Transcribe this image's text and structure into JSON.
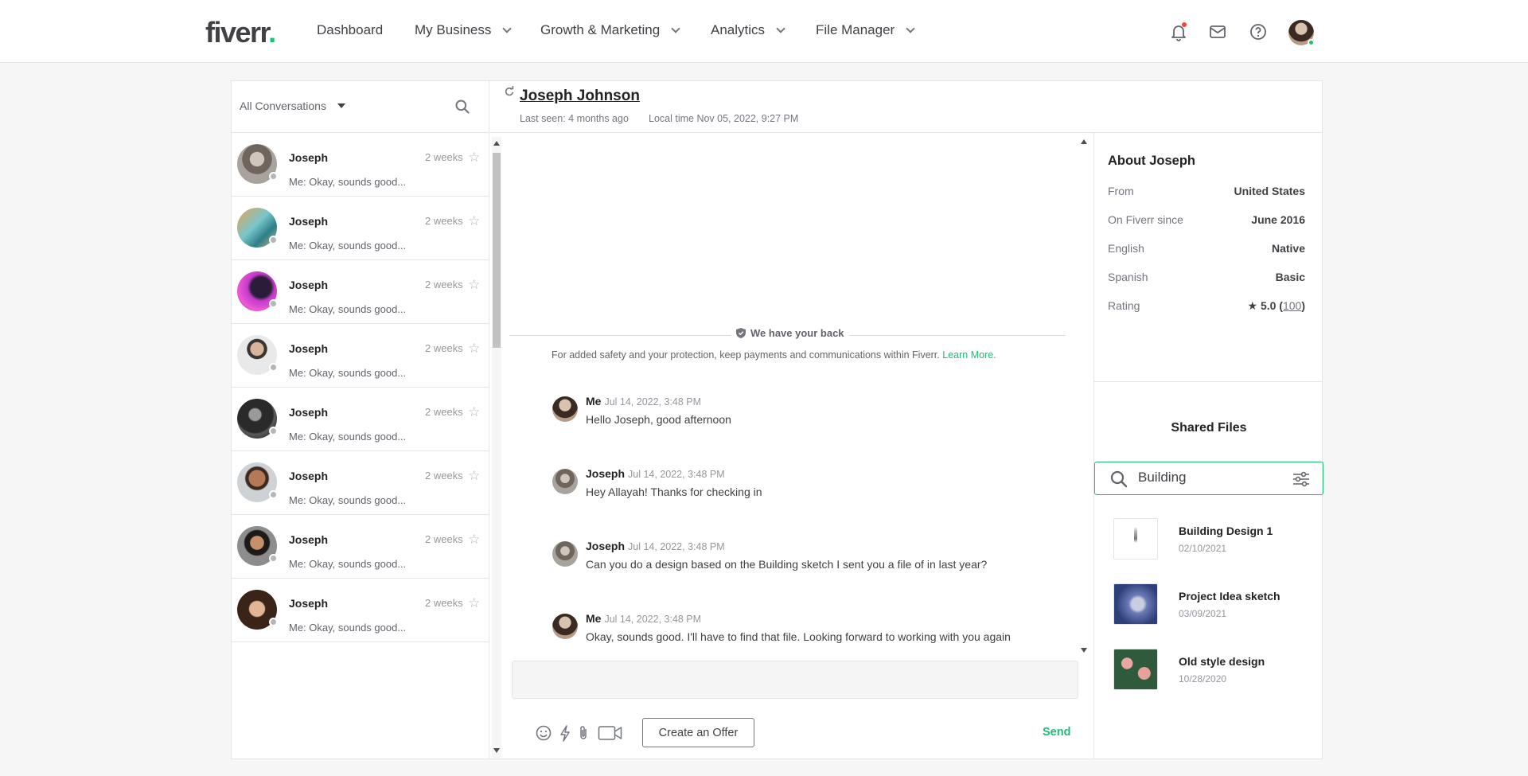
{
  "nav": {
    "logo_text": "fiverr",
    "logo_dot": ".",
    "items": [
      {
        "label": "Dashboard",
        "has_dropdown": false
      },
      {
        "label": "My Business",
        "has_dropdown": true
      },
      {
        "label": "Growth & Marketing",
        "has_dropdown": true
      },
      {
        "label": "Analytics",
        "has_dropdown": true
      },
      {
        "label": "File Manager",
        "has_dropdown": true
      }
    ],
    "icons": [
      "bell-icon",
      "mail-icon",
      "help-icon"
    ],
    "accent_color": "#1dbf73"
  },
  "conversations": {
    "filter_label": "All Conversations",
    "items": [
      {
        "name": "Joseph",
        "time": "2 weeks",
        "preview": "Me: Okay, sounds good..."
      },
      {
        "name": "Joseph",
        "time": "2 weeks",
        "preview": "Me: Okay, sounds good..."
      },
      {
        "name": "Joseph",
        "time": "2 weeks",
        "preview": "Me: Okay, sounds good..."
      },
      {
        "name": "Joseph",
        "time": "2 weeks",
        "preview": "Me: Okay, sounds good..."
      },
      {
        "name": "Joseph",
        "time": "2 weeks",
        "preview": "Me: Okay, sounds good..."
      },
      {
        "name": "Joseph",
        "time": "2 weeks",
        "preview": "Me: Okay, sounds good..."
      },
      {
        "name": "Joseph",
        "time": "2 weeks",
        "preview": "Me: Okay, sounds good..."
      },
      {
        "name": "Joseph",
        "time": "2 weeks",
        "preview": "Me: Okay, sounds good..."
      }
    ]
  },
  "chat": {
    "contact_name": "Joseph Johnson",
    "last_seen": "Last seen: 4 months ago",
    "local_time": "Local time Nov 05, 2022, 9:27 PM",
    "safety_title": "We have your back",
    "safety_text": "For added safety and your protection, keep payments and communications within Fiverr.",
    "safety_link": "Learn More.",
    "messages": [
      {
        "sender": "Me",
        "time": "Jul 14, 2022, 3:48 PM",
        "text": "Hello Joseph, good afternoon"
      },
      {
        "sender": "Joseph",
        "time": "Jul 14, 2022, 3:48 PM",
        "text": "Hey Allayah! Thanks for checking in"
      },
      {
        "sender": "Joseph",
        "time": "Jul 14, 2022, 3:48 PM",
        "text": "Can you do a design based on the Building sketch I sent you a file of in last year?"
      },
      {
        "sender": "Me",
        "time": "Jul 14, 2022, 3:48 PM",
        "text": "Okay, sounds good. I'll have to find that file. Looking forward to working with you again"
      }
    ],
    "composer_placeholder": "",
    "offer_label": "Create an Offer",
    "send_label": "Send"
  },
  "about": {
    "title": "About Joseph",
    "rows": [
      {
        "key": "From",
        "value": "United States"
      },
      {
        "key": "On Fiverr since",
        "value": "June 2016"
      },
      {
        "key": "English",
        "value": "Native"
      },
      {
        "key": "Spanish",
        "value": "Basic"
      }
    ],
    "rating_label": "Rating",
    "rating_value": "5.0",
    "rating_count": "100"
  },
  "shared_files": {
    "title": "Shared Files",
    "search_value": "Building",
    "items": [
      {
        "name": "Building Design 1",
        "date": "02/10/2021"
      },
      {
        "name": "Project Idea sketch",
        "date": "03/09/2021"
      },
      {
        "name": "Old style design",
        "date": "10/28/2020"
      }
    ]
  }
}
